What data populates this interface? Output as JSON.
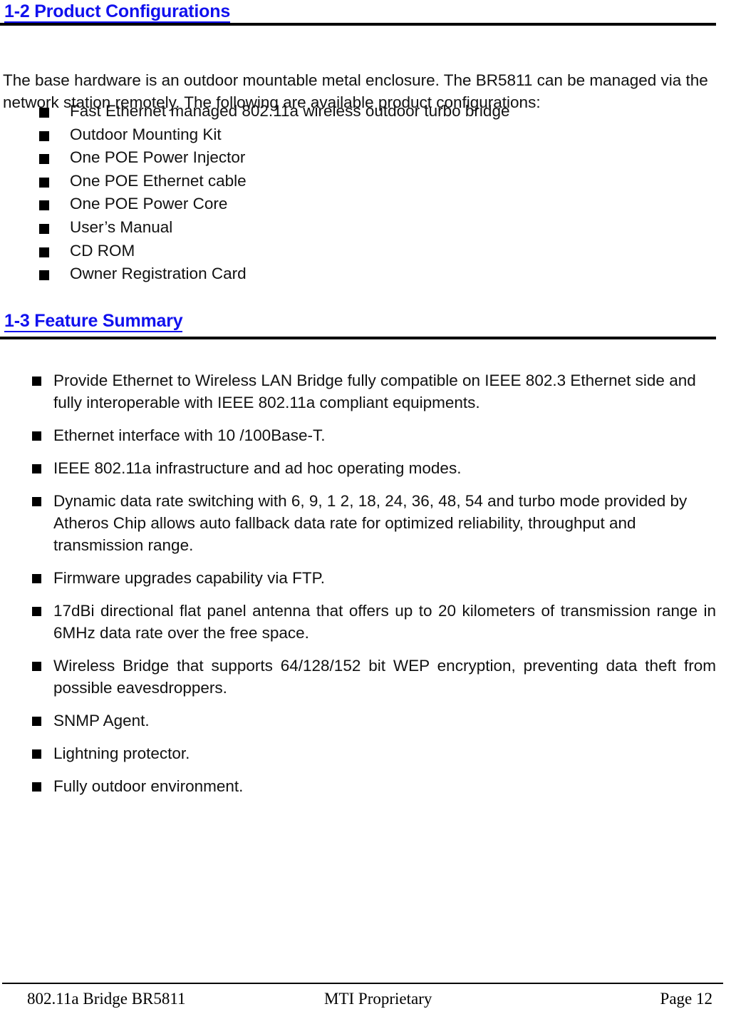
{
  "document": {
    "sections": [
      {
        "id": "product-configurations",
        "number": "1-2",
        "title": "1-2 Product Configurations"
      },
      {
        "id": "feature-summary",
        "number": "1-3",
        "title": "1-3 Feature Summary"
      }
    ],
    "intro_paragraph": "The base hardware is an outdoor mountable metal enclosure. The BR5811 can be managed via the network station remotely. The following are available product configurations:",
    "config_items": [
      "Fast Ethernet managed 802.11a wireless outdoor turbo bridge",
      "Outdoor Mounting Kit",
      "One POE Power Injector",
      "One POE Ethernet cable",
      "One POE Power Core",
      "User’s Manual",
      "CD ROM",
      "Owner Registration Card"
    ],
    "feature_items": [
      "Provide Ethernet to Wireless LAN Bridge fully compatible on IEEE 802.3 Ethernet side and fully interoperable with IEEE 802.11a compliant equipments.",
      "Ethernet interface with 10 /100Base-T.",
      "IEEE 802.11a infrastructure and ad hoc operating modes.",
      "Dynamic data rate switching with 6, 9, 1 2, 18, 24, 36, 48, 54 and turbo mode provided by Atheros Chip allows auto fallback data rate for optimized reliability, throughput and transmission range.",
      "Firmware upgrades capability via FTP.",
      "17dBi directional flat panel antenna that offers up to 20 kilometers of transmission range in 6MHz data rate over the free space.",
      "Wireless Bridge that supports 64/128/152 bit WEP encryption, preventing data theft from possible eavesdroppers.",
      "SNMP Agent.",
      "Lightning protector.",
      "Fully outdoor environment."
    ],
    "footer": {
      "left": "802.11a Bridge BR5811",
      "center": "MTI Proprietary",
      "right": "Page 12"
    },
    "colors": {
      "heading": "#1111ee",
      "body_text": "#111111",
      "rule": "#000000",
      "background": "#ffffff"
    }
  }
}
